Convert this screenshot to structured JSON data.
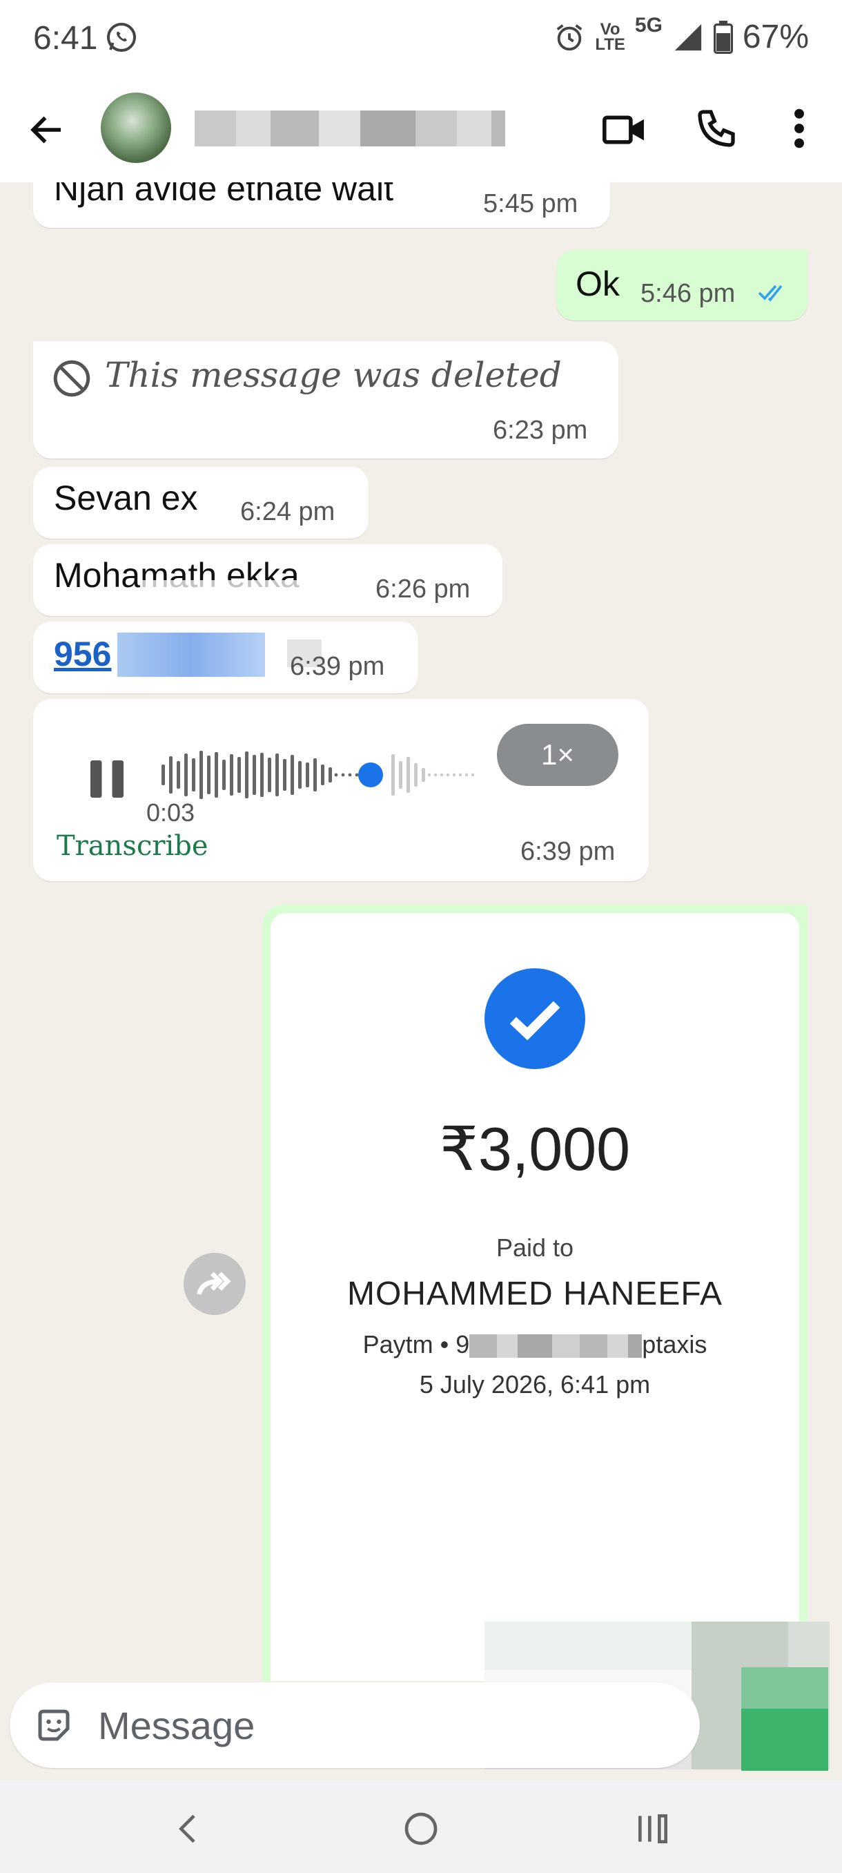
{
  "status_bar": {
    "time": "6:41",
    "network_vo": "Vo",
    "network_lte": "LTE",
    "network_5g": "5G",
    "battery": "67%",
    "icons": [
      "whatsapp-icon",
      "alarm-icon",
      "volte-icon",
      "signal-icon",
      "battery-icon"
    ]
  },
  "header": {
    "contact_name": "",
    "icons": [
      "back-arrow-icon",
      "avatar",
      "video-call-icon",
      "phone-icon",
      "more-vert-icon"
    ]
  },
  "messages": [
    {
      "dir": "in",
      "text": "Njan avide ethate wait",
      "time": "5:45 pm"
    },
    {
      "dir": "out",
      "text": "Ok",
      "time": "5:46 pm",
      "ticks": "read"
    },
    {
      "dir": "in",
      "deleted": true,
      "text": "This message was deleted",
      "time": "6:23 pm"
    },
    {
      "dir": "in",
      "text": "Sevan ex",
      "time": "6:24 pm"
    },
    {
      "dir": "in",
      "text": "Mohamath ekka",
      "time": "6:26 pm"
    },
    {
      "dir": "in",
      "link": "956",
      "time": "6:39 pm"
    },
    {
      "dir": "in",
      "voice": true,
      "duration": "0:03",
      "speed": "1×",
      "transcribe": "Transcribe",
      "time": "6:39 pm"
    }
  ],
  "payment_image": {
    "amount": "₹3,000",
    "paid_to_label": "Paid to",
    "payee": "MOHAMMED HANEEFA",
    "method_prefix": "Paytm • 9",
    "method_suffix": "ptaxis",
    "date": "5 July 2026, 6:41 pm"
  },
  "composer": {
    "placeholder": "Message"
  },
  "colors": {
    "chat_bg": "#f2efe8",
    "outgoing_bubble": "#d9fdd3",
    "incoming_bubble": "#ffffff",
    "read_tick": "#34a0e6",
    "link": "#1a62c7",
    "voice_dot": "#1a73e8",
    "transcribe": "#1b7a4a",
    "check_circle": "#1a73e8"
  }
}
